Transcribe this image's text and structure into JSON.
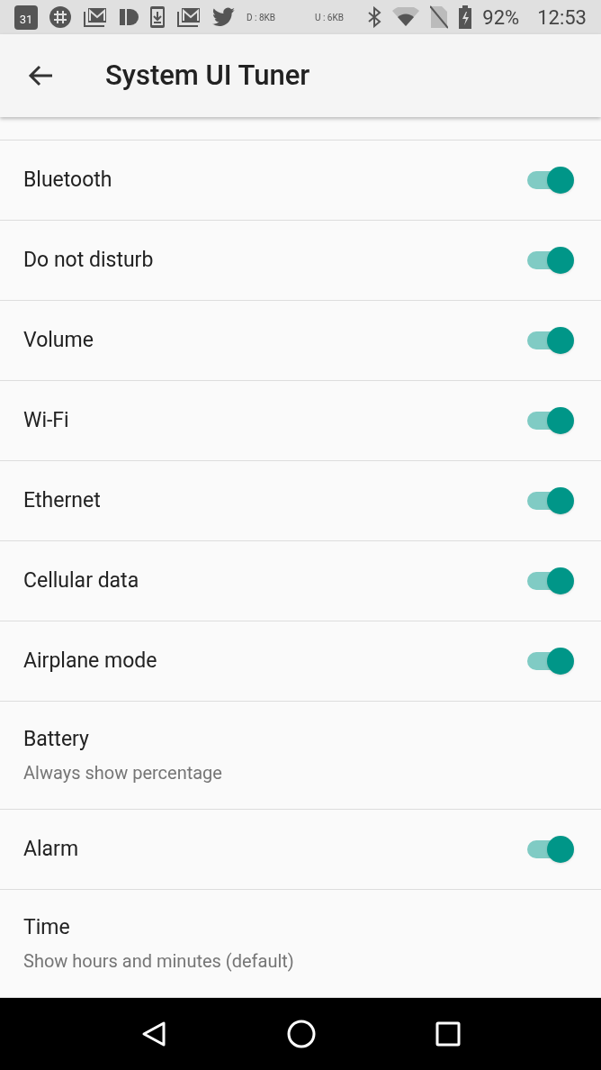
{
  "status_bar": {
    "calendar_day": "31",
    "download": "D : 8KB",
    "upload": "U : 6KB",
    "battery": "92%",
    "time": "12:53"
  },
  "app_bar": {
    "title": "System UI Tuner"
  },
  "items": [
    {
      "kind": "toggle",
      "title": "Bluetooth",
      "on": true
    },
    {
      "kind": "toggle",
      "title": "Do not disturb",
      "on": true
    },
    {
      "kind": "toggle",
      "title": "Volume",
      "on": true
    },
    {
      "kind": "toggle",
      "title": "Wi-Fi",
      "on": true
    },
    {
      "kind": "toggle",
      "title": "Ethernet",
      "on": true
    },
    {
      "kind": "toggle",
      "title": "Cellular data",
      "on": true
    },
    {
      "kind": "toggle",
      "title": "Airplane mode",
      "on": true
    },
    {
      "kind": "choice",
      "title": "Battery",
      "summary": "Always show percentage"
    },
    {
      "kind": "toggle",
      "title": "Alarm",
      "on": true
    },
    {
      "kind": "choice",
      "title": "Time",
      "summary": "Show hours and minutes (default)"
    }
  ]
}
